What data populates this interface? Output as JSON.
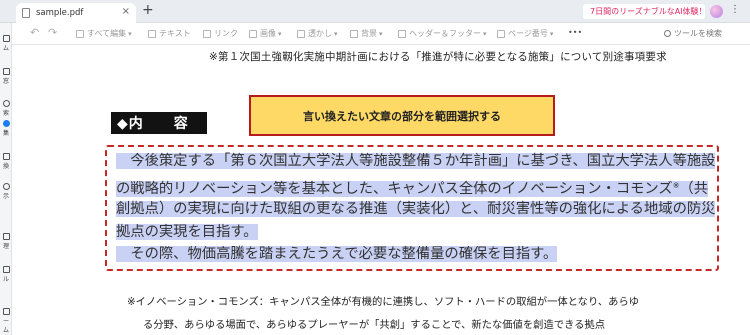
{
  "tabbar": {
    "tab_label": "sample.pdf",
    "new_tab_symbol": "+",
    "promo_text": "7日間のリーズナブルなAI体験！",
    "menu_symbol": "⋮"
  },
  "toolbar": {
    "undo_symbol": "↶",
    "redo_symbol": "↷",
    "items": [
      {
        "label": "すべて編集"
      },
      {
        "label": "テキスト"
      },
      {
        "label": "リンク"
      },
      {
        "label": "画像"
      },
      {
        "label": "透かし"
      },
      {
        "label": "背景"
      },
      {
        "label": "ヘッダー＆フッター"
      },
      {
        "label": "ページ番号"
      }
    ],
    "more_symbol": "•••",
    "tool_search_label": "ツールを検索"
  },
  "sidebar": {
    "items": [
      "ム",
      "窓",
      "索",
      "集",
      "換",
      "示",
      "理",
      "ル",
      "ーム"
    ]
  },
  "document": {
    "note_top": "※第１次国土強靱化実施中期計画における「推進が特に必要となる施策」について別途事項要求",
    "heading": "◆内　　容",
    "callout": "言い換えたい文章の部分を範囲選択する",
    "selected_lines": [
      "　今後策定する「第６次国立大学法人等施設整備５か年計画」に基づき、国立大学法人等施設",
      "の戦略的リノベーション等を基本とした、キャンパス全体のイノベーション・コモンズ",
      "創拠点）の実現に向けた取組の更なる推進（実装化）と、耐災害性等の強化による地域の防災",
      "拠点の実現を目指す。",
      "　その際、物価高騰を踏まえたうえで必要な整備量の確保を目指す。"
    ],
    "line2_sup": "※",
    "line2_tail": "（共",
    "footnote_line1": "※イノベーション・コモンズ：キャンパス全体が有機的に連携し、ソフト・ハードの取組が一体となり、あらゆ",
    "footnote_line2": "る分野、あらゆる場面で、あらゆるプレーヤーが「共創」することで、新たな価値を創造できる拠点"
  },
  "colors": {
    "selection_highlight": "#c9d2f5",
    "callout_fill": "#ffd966",
    "callout_border": "#b71c1c",
    "dashed_border": "#c62828",
    "heading_fill": "#121212"
  }
}
